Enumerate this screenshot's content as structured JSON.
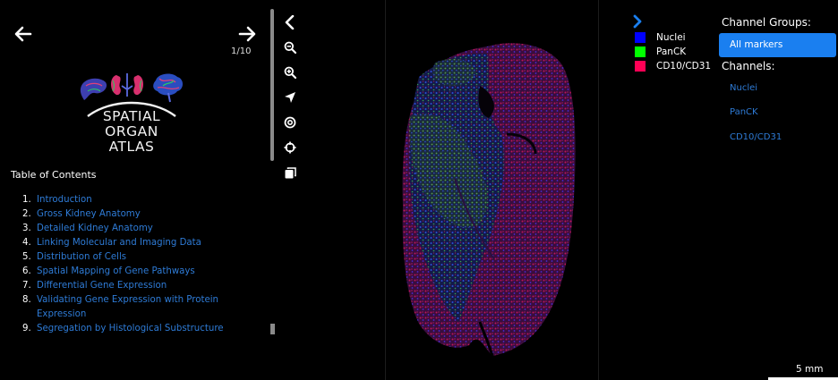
{
  "nav": {
    "back_icon": "arrow-left-icon",
    "forward_icon": "arrow-right-icon",
    "page_indicator": "1/10"
  },
  "logo": {
    "lines": [
      "SPATIAL",
      "ORGAN",
      "ATLAS"
    ]
  },
  "toc": {
    "title": "Table of Contents",
    "items": [
      {
        "num": "1.",
        "label": "Introduction"
      },
      {
        "num": "2.",
        "label": "Gross Kidney Anatomy"
      },
      {
        "num": "3.",
        "label": "Detailed Kidney Anatomy"
      },
      {
        "num": "4.",
        "label": "Linking Molecular and Imaging Data"
      },
      {
        "num": "5.",
        "label": "Distribution of Cells"
      },
      {
        "num": "6.",
        "label": "Spatial Mapping of Gene Pathways"
      },
      {
        "num": "7.",
        "label": "Differential Gene Expression"
      },
      {
        "num": "8.",
        "label": "Validating Gene Expression with Protein Expression"
      },
      {
        "num": "9.",
        "label": "Segregation by Histological Substructure"
      }
    ]
  },
  "toolbar": {
    "tools": [
      "chevron-left-icon",
      "zoom-out-icon",
      "zoom-in-icon",
      "navigate-arrow-icon",
      "target-icon",
      "crosshair-icon",
      "copy-icon"
    ]
  },
  "legend": {
    "items": [
      {
        "label": "Nuclei",
        "color": "#0000ff"
      },
      {
        "label": "PanCK",
        "color": "#00ff00"
      },
      {
        "label": "CD10/CD31",
        "color": "#ff0055"
      }
    ]
  },
  "channel_panel": {
    "groups_heading": "Channel Groups:",
    "active_group": "All markers",
    "channels_heading": "Channels:",
    "channels": [
      "Nuclei",
      "PanCK",
      "CD10/CD31"
    ],
    "accent": "#1a7ff0"
  },
  "scale": {
    "label": "5 mm"
  }
}
